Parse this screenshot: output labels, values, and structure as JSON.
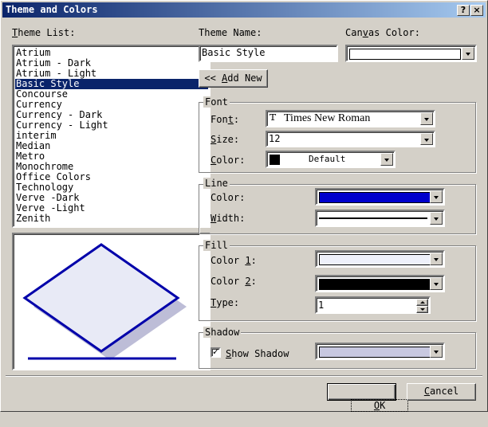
{
  "window": {
    "title": "Theme and Colors",
    "help_glyph": "?",
    "close_glyph": "×"
  },
  "theme_list": {
    "label": "Theme List:",
    "items": [
      "Atrium",
      "Atrium - Dark",
      "Atrium - Light",
      "Basic Style",
      "Concourse",
      "Currency",
      "Currency - Dark",
      "Currency - Light",
      "interim",
      "Median",
      "Metro",
      "Monochrome",
      "Office Colors",
      "Technology",
      "Verve -Dark",
      "Verve -Light",
      "Zenith"
    ],
    "selected": "Basic Style"
  },
  "theme_name": {
    "label": "Theme Name:",
    "value": "Basic Style"
  },
  "canvas_color": {
    "label": "Canvas Color:",
    "color": "#ffffff"
  },
  "add_new_button": "<< Add New",
  "font_group": {
    "title": "Font",
    "font_label": "Font:",
    "font_value": "Times New Roman",
    "font_icon": "truetype-font-icon",
    "size_label": "Size:",
    "size_value": "12",
    "color_label": "Color:",
    "color_value": "Default",
    "color_swatch": "#000000"
  },
  "line_group": {
    "title": "Line",
    "color_label": "Color:",
    "color": "#0000cc",
    "width_label": "Width:"
  },
  "fill_group": {
    "title": "Fill",
    "color1_label": "Color 1:",
    "color1": "#eef0fa",
    "color2_label": "Color 2:",
    "color2": "#000000",
    "type_label": "Type:",
    "type_value": "1"
  },
  "shadow_group": {
    "title": "Shadow",
    "show_shadow_label": "Show Shadow",
    "show_shadow_checked": true,
    "shadow_color": "#c8c8e0"
  },
  "preview": {
    "fill": "#e8eaf6",
    "stroke": "#0000aa",
    "shadow": "#bdbdd7"
  },
  "ok_button": "OK",
  "cancel_button": "Cancel"
}
